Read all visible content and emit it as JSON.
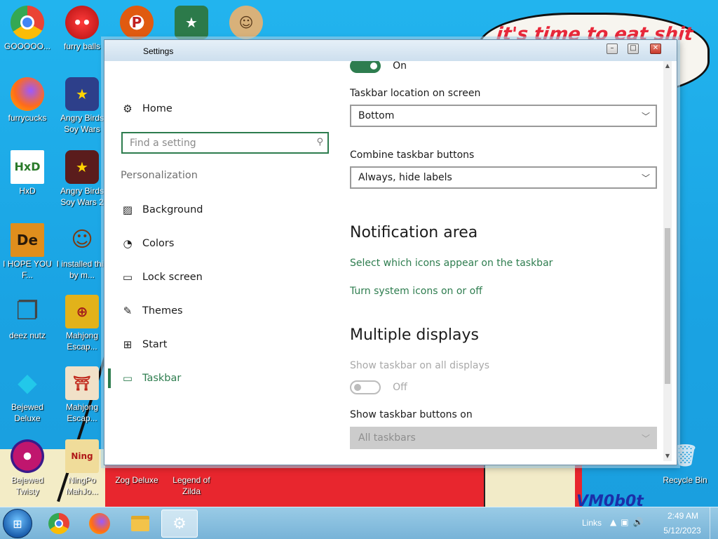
{
  "desktop": {
    "bubble_text": "it's time to eat shit",
    "corner_text": "VM0b0t",
    "icons": [
      {
        "label": "GOOOOO...",
        "color": "#ea4335",
        "glyph": "●"
      },
      {
        "label": "furry balls",
        "color": "#d61f1f",
        "glyph": "●"
      },
      {
        "label": "",
        "color": "#e05a10",
        "glyph": "P"
      },
      {
        "label": "",
        "color": "#2c7a4a",
        "glyph": "★"
      },
      {
        "label": "",
        "color": "#d8b17a",
        "glyph": "☺"
      },
      {
        "label": "furrycucks",
        "color": "#ff6b1a",
        "glyph": "●"
      },
      {
        "label": "Angry Birds Soy Wars",
        "color": "#2d3f8a",
        "glyph": "★"
      },
      {
        "label": "HxD",
        "color": "#ffffff",
        "glyph": "HxD"
      },
      {
        "label": "Angry Birds Soy Wars 2",
        "color": "#5a1c1c",
        "glyph": "★"
      },
      {
        "label": "I HOPE YOU F...",
        "color": "#d68a1a",
        "glyph": "De"
      },
      {
        "label": "I installed this by m...",
        "color": "#3aa6e6",
        "glyph": "☺"
      },
      {
        "label": "deez nutz",
        "color": "#555555",
        "glyph": "❐"
      },
      {
        "label": "Mahjong Escap...",
        "color": "#e2b21a",
        "glyph": "⊕"
      },
      {
        "label": "Bejewed Deluxe",
        "color": "#1ec2e0",
        "glyph": "◆"
      },
      {
        "label": "Mahjong Escap...",
        "color": "#f1e1c8",
        "glyph": "⛩"
      },
      {
        "label": "Bejewed Twisty",
        "color": "#c0166e",
        "glyph": "◆"
      },
      {
        "label": "NingPo MahJo...",
        "color": "#e6cf8f",
        "glyph": "Ning"
      },
      {
        "label": "Zog Deluxe",
        "color": "",
        "glyph": ""
      },
      {
        "label": "Legend of Zilda",
        "color": "",
        "glyph": ""
      },
      {
        "label": "Recycle Bin",
        "color": "#b8d8ee",
        "glyph": "🗑"
      }
    ]
  },
  "window": {
    "title": "Settings",
    "controls": {
      "minimize": "–",
      "maximize": "□",
      "close": "✕"
    }
  },
  "nav": {
    "home": "Home",
    "search_placeholder": "Find a setting",
    "section": "Personalization",
    "items": [
      {
        "label": "Background",
        "icon": "image-icon"
      },
      {
        "label": "Colors",
        "icon": "palette-icon"
      },
      {
        "label": "Lock screen",
        "icon": "lock-screen-icon"
      },
      {
        "label": "Themes",
        "icon": "themes-icon"
      },
      {
        "label": "Start",
        "icon": "start-icon"
      },
      {
        "label": "Taskbar",
        "icon": "taskbar-icon",
        "active": true
      }
    ]
  },
  "content": {
    "top_toggle": {
      "state": "On"
    },
    "location_label": "Taskbar location on screen",
    "location_value": "Bottom",
    "combine_label": "Combine taskbar buttons",
    "combine_value": "Always, hide labels",
    "notification_heading": "Notification area",
    "link_icons": "Select which icons appear on the taskbar",
    "link_system": "Turn system icons on or off",
    "multi_heading": "Multiple displays",
    "show_all_label": "Show taskbar on all displays",
    "show_all_state": "Off",
    "buttons_on_label": "Show taskbar buttons on",
    "buttons_on_value": "All taskbars"
  },
  "taskbar": {
    "links": "Links",
    "time": "2:49 AM",
    "date": "5/12/2023",
    "apps": [
      "chrome",
      "firefox",
      "file-explorer",
      "settings"
    ]
  },
  "colors": {
    "accent": "#2e7d4f",
    "desktop": "#1aa6e6"
  }
}
